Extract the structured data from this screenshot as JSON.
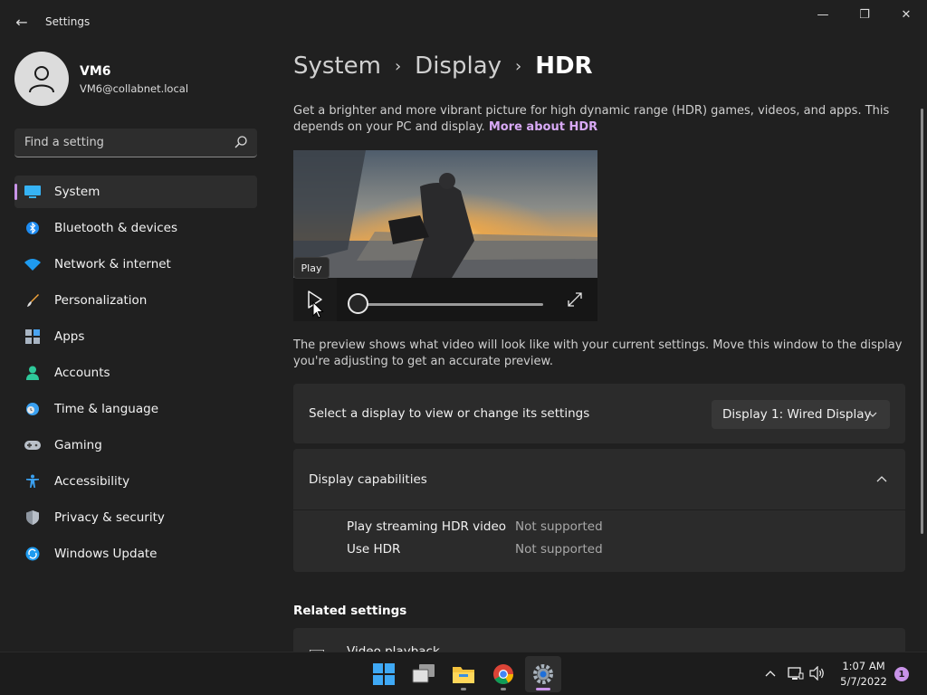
{
  "window": {
    "title": "Settings",
    "back_glyph": "←",
    "minimize_glyph": "—",
    "maximize_glyph": "❐",
    "close_glyph": "✕"
  },
  "user": {
    "name": "VM6",
    "email": "VM6@collabnet.local"
  },
  "search": {
    "placeholder": "Find a setting"
  },
  "nav": {
    "items": [
      {
        "label": "System",
        "icon": "system-icon",
        "active": true
      },
      {
        "label": "Bluetooth & devices",
        "icon": "bluetooth-icon"
      },
      {
        "label": "Network & internet",
        "icon": "wifi-icon"
      },
      {
        "label": "Personalization",
        "icon": "brush-icon"
      },
      {
        "label": "Apps",
        "icon": "apps-icon"
      },
      {
        "label": "Accounts",
        "icon": "person-icon"
      },
      {
        "label": "Time & language",
        "icon": "clock-globe-icon"
      },
      {
        "label": "Gaming",
        "icon": "gamepad-icon"
      },
      {
        "label": "Accessibility",
        "icon": "accessibility-icon"
      },
      {
        "label": "Privacy & security",
        "icon": "shield-icon"
      },
      {
        "label": "Windows Update",
        "icon": "update-icon"
      }
    ]
  },
  "breadcrumb": {
    "items": [
      "System",
      "Display",
      "HDR"
    ],
    "separator": "›"
  },
  "page": {
    "description": "Get a brighter and more vibrant picture for high dynamic range (HDR) games, videos, and apps. This depends on your PC and display.",
    "more_link": "More about HDR",
    "preview_note": "The preview shows what video will look like with your current settings. Move this window to the display you're adjusting to get an accurate preview."
  },
  "video": {
    "tooltip": "Play",
    "progress": 0
  },
  "display_select": {
    "label": "Select a display to view or change its settings",
    "selected": "Display 1: Wired Display"
  },
  "capabilities": {
    "title": "Display capabilities",
    "rows": [
      {
        "label": "Play streaming HDR video",
        "value": "Not supported"
      },
      {
        "label": "Use HDR",
        "value": "Not supported"
      }
    ]
  },
  "related": {
    "heading": "Related settings",
    "items": [
      {
        "label": "Video playback"
      }
    ]
  },
  "taskbar": {
    "apps": [
      "start-icon",
      "task-view-icon",
      "file-explorer-icon",
      "chrome-icon",
      "settings-icon"
    ],
    "active_app": "settings-icon",
    "time": "1:07 AM",
    "date": "5/7/2022",
    "notifications": "1"
  },
  "colors": {
    "accent": "#c893e8",
    "link": "#d8a9f5",
    "background": "#202020",
    "card": "#2b2b2b"
  }
}
